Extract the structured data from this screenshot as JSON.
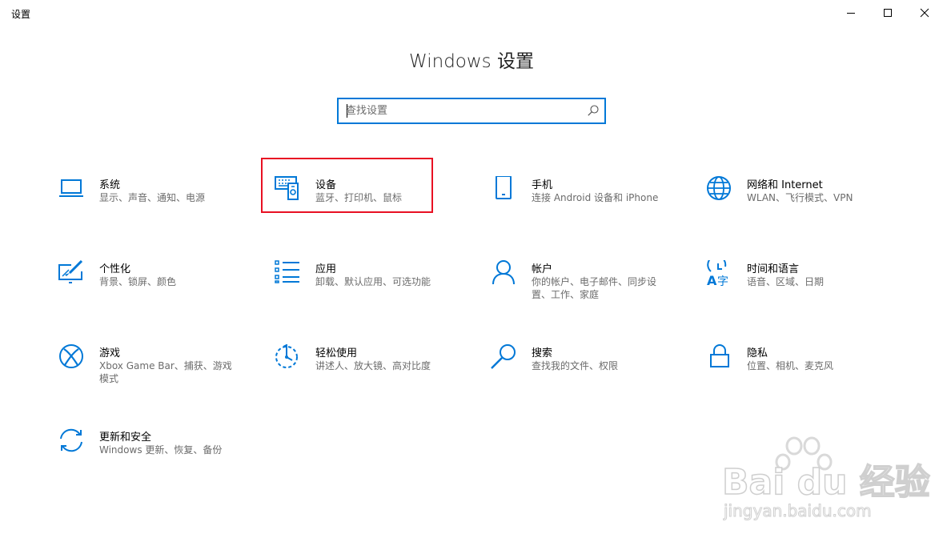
{
  "window": {
    "title": "设置"
  },
  "header": {
    "title": "Windows 设置"
  },
  "search": {
    "placeholder": "查找设置"
  },
  "tiles": [
    {
      "name": "系统",
      "desc": "显示、声音、通知、电源",
      "icon": "laptop-icon"
    },
    {
      "name": "设备",
      "desc": "蓝牙、打印机、鼠标",
      "icon": "devices-icon"
    },
    {
      "name": "手机",
      "desc": "连接 Android 设备和 iPhone",
      "icon": "phone-icon"
    },
    {
      "name": "网络和 Internet",
      "desc": "WLAN、飞行模式、VPN",
      "icon": "globe-icon"
    },
    {
      "name": "个性化",
      "desc": "背景、锁屏、颜色",
      "icon": "paintbrush-icon"
    },
    {
      "name": "应用",
      "desc": "卸载、默认应用、可选功能",
      "icon": "apps-list-icon"
    },
    {
      "name": "帐户",
      "desc": "你的帐户、电子邮件、同步设置、工作、家庭",
      "icon": "person-icon"
    },
    {
      "name": "时间和语言",
      "desc": "语音、区域、日期",
      "icon": "time-language-icon"
    },
    {
      "name": "游戏",
      "desc": "Xbox Game Bar、捕获、游戏模式",
      "icon": "xbox-icon"
    },
    {
      "name": "轻松使用",
      "desc": "讲述人、放大镜、高对比度",
      "icon": "ease-of-access-icon"
    },
    {
      "name": "搜索",
      "desc": "查找我的文件、权限",
      "icon": "search-icon"
    },
    {
      "name": "隐私",
      "desc": "位置、相机、麦克风",
      "icon": "lock-icon"
    },
    {
      "name": "更新和安全",
      "desc": "Windows 更新、恢复、备份",
      "icon": "sync-icon"
    }
  ],
  "highlighted_tile": "设备",
  "watermark": {
    "brand": "Bai du 经验",
    "url": "jingyan.baidu.com"
  },
  "colors": {
    "accent": "#0078d7",
    "highlight": "#e81123",
    "desc_text": "#6b6b6b"
  }
}
